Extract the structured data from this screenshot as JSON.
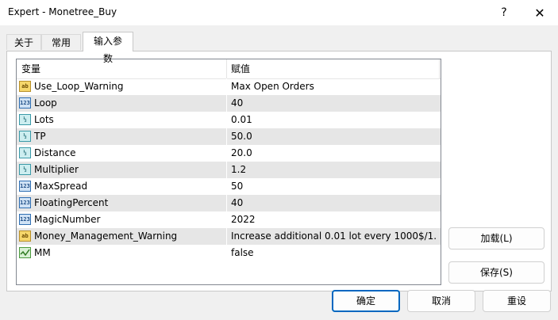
{
  "window": {
    "title": "Expert - Monetree_Buy",
    "help_glyph": "?",
    "close_glyph": "✕"
  },
  "tabs": {
    "about": "关于",
    "common": "常用",
    "inputs": "输入参数"
  },
  "grid": {
    "header_variable": "变量",
    "header_value": "赋值",
    "rows": [
      {
        "icon": "ab-string-icon",
        "name": "Use_Loop_Warning",
        "value": "Max Open Orders"
      },
      {
        "icon": "123-integer-icon",
        "name": "Loop",
        "value": "40"
      },
      {
        "icon": "fraction-double-icon",
        "name": "Lots",
        "value": "0.01"
      },
      {
        "icon": "fraction-double-icon",
        "name": "TP",
        "value": "50.0"
      },
      {
        "icon": "fraction-double-icon",
        "name": "Distance",
        "value": "20.0"
      },
      {
        "icon": "fraction-double-icon",
        "name": "Multiplier",
        "value": "1.2"
      },
      {
        "icon": "123-integer-icon",
        "name": "MaxSpread",
        "value": "50"
      },
      {
        "icon": "123-integer-icon",
        "name": "FloatingPercent",
        "value": "40"
      },
      {
        "icon": "123-integer-icon",
        "name": "MagicNumber",
        "value": "2022"
      },
      {
        "icon": "ab-string-icon",
        "name": "Money_Management_Warning",
        "value": "Increase additional 0.01 lot every 1000$/1..."
      },
      {
        "icon": "bool-icon",
        "name": "MM",
        "value": "false"
      }
    ]
  },
  "buttons": {
    "load": "加载(L)",
    "save": "保存(S)",
    "ok": "确定",
    "cancel": "取消",
    "reset": "重设"
  },
  "colors": {
    "accent": "#0067c0",
    "alt_row": "#e6e6e6"
  }
}
